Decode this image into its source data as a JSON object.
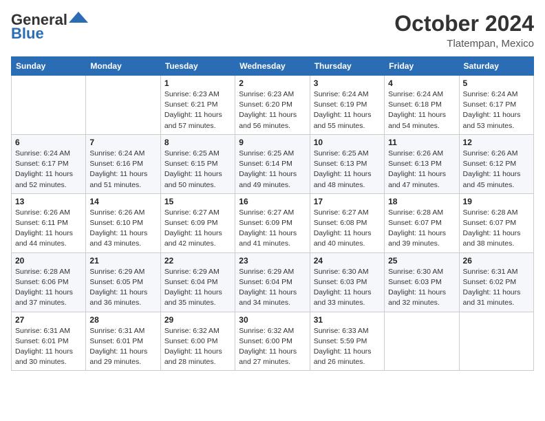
{
  "header": {
    "logo_general": "General",
    "logo_blue": "Blue",
    "month": "October 2024",
    "location": "Tlatempan, Mexico"
  },
  "weekdays": [
    "Sunday",
    "Monday",
    "Tuesday",
    "Wednesday",
    "Thursday",
    "Friday",
    "Saturday"
  ],
  "weeks": [
    [
      {
        "day": "",
        "info": ""
      },
      {
        "day": "",
        "info": ""
      },
      {
        "day": "1",
        "info": "Sunrise: 6:23 AM\nSunset: 6:21 PM\nDaylight: 11 hours and 57 minutes."
      },
      {
        "day": "2",
        "info": "Sunrise: 6:23 AM\nSunset: 6:20 PM\nDaylight: 11 hours and 56 minutes."
      },
      {
        "day": "3",
        "info": "Sunrise: 6:24 AM\nSunset: 6:19 PM\nDaylight: 11 hours and 55 minutes."
      },
      {
        "day": "4",
        "info": "Sunrise: 6:24 AM\nSunset: 6:18 PM\nDaylight: 11 hours and 54 minutes."
      },
      {
        "day": "5",
        "info": "Sunrise: 6:24 AM\nSunset: 6:17 PM\nDaylight: 11 hours and 53 minutes."
      }
    ],
    [
      {
        "day": "6",
        "info": "Sunrise: 6:24 AM\nSunset: 6:17 PM\nDaylight: 11 hours and 52 minutes."
      },
      {
        "day": "7",
        "info": "Sunrise: 6:24 AM\nSunset: 6:16 PM\nDaylight: 11 hours and 51 minutes."
      },
      {
        "day": "8",
        "info": "Sunrise: 6:25 AM\nSunset: 6:15 PM\nDaylight: 11 hours and 50 minutes."
      },
      {
        "day": "9",
        "info": "Sunrise: 6:25 AM\nSunset: 6:14 PM\nDaylight: 11 hours and 49 minutes."
      },
      {
        "day": "10",
        "info": "Sunrise: 6:25 AM\nSunset: 6:13 PM\nDaylight: 11 hours and 48 minutes."
      },
      {
        "day": "11",
        "info": "Sunrise: 6:26 AM\nSunset: 6:13 PM\nDaylight: 11 hours and 47 minutes."
      },
      {
        "day": "12",
        "info": "Sunrise: 6:26 AM\nSunset: 6:12 PM\nDaylight: 11 hours and 45 minutes."
      }
    ],
    [
      {
        "day": "13",
        "info": "Sunrise: 6:26 AM\nSunset: 6:11 PM\nDaylight: 11 hours and 44 minutes."
      },
      {
        "day": "14",
        "info": "Sunrise: 6:26 AM\nSunset: 6:10 PM\nDaylight: 11 hours and 43 minutes."
      },
      {
        "day": "15",
        "info": "Sunrise: 6:27 AM\nSunset: 6:09 PM\nDaylight: 11 hours and 42 minutes."
      },
      {
        "day": "16",
        "info": "Sunrise: 6:27 AM\nSunset: 6:09 PM\nDaylight: 11 hours and 41 minutes."
      },
      {
        "day": "17",
        "info": "Sunrise: 6:27 AM\nSunset: 6:08 PM\nDaylight: 11 hours and 40 minutes."
      },
      {
        "day": "18",
        "info": "Sunrise: 6:28 AM\nSunset: 6:07 PM\nDaylight: 11 hours and 39 minutes."
      },
      {
        "day": "19",
        "info": "Sunrise: 6:28 AM\nSunset: 6:07 PM\nDaylight: 11 hours and 38 minutes."
      }
    ],
    [
      {
        "day": "20",
        "info": "Sunrise: 6:28 AM\nSunset: 6:06 PM\nDaylight: 11 hours and 37 minutes."
      },
      {
        "day": "21",
        "info": "Sunrise: 6:29 AM\nSunset: 6:05 PM\nDaylight: 11 hours and 36 minutes."
      },
      {
        "day": "22",
        "info": "Sunrise: 6:29 AM\nSunset: 6:04 PM\nDaylight: 11 hours and 35 minutes."
      },
      {
        "day": "23",
        "info": "Sunrise: 6:29 AM\nSunset: 6:04 PM\nDaylight: 11 hours and 34 minutes."
      },
      {
        "day": "24",
        "info": "Sunrise: 6:30 AM\nSunset: 6:03 PM\nDaylight: 11 hours and 33 minutes."
      },
      {
        "day": "25",
        "info": "Sunrise: 6:30 AM\nSunset: 6:03 PM\nDaylight: 11 hours and 32 minutes."
      },
      {
        "day": "26",
        "info": "Sunrise: 6:31 AM\nSunset: 6:02 PM\nDaylight: 11 hours and 31 minutes."
      }
    ],
    [
      {
        "day": "27",
        "info": "Sunrise: 6:31 AM\nSunset: 6:01 PM\nDaylight: 11 hours and 30 minutes."
      },
      {
        "day": "28",
        "info": "Sunrise: 6:31 AM\nSunset: 6:01 PM\nDaylight: 11 hours and 29 minutes."
      },
      {
        "day": "29",
        "info": "Sunrise: 6:32 AM\nSunset: 6:00 PM\nDaylight: 11 hours and 28 minutes."
      },
      {
        "day": "30",
        "info": "Sunrise: 6:32 AM\nSunset: 6:00 PM\nDaylight: 11 hours and 27 minutes."
      },
      {
        "day": "31",
        "info": "Sunrise: 6:33 AM\nSunset: 5:59 PM\nDaylight: 11 hours and 26 minutes."
      },
      {
        "day": "",
        "info": ""
      },
      {
        "day": "",
        "info": ""
      }
    ]
  ]
}
